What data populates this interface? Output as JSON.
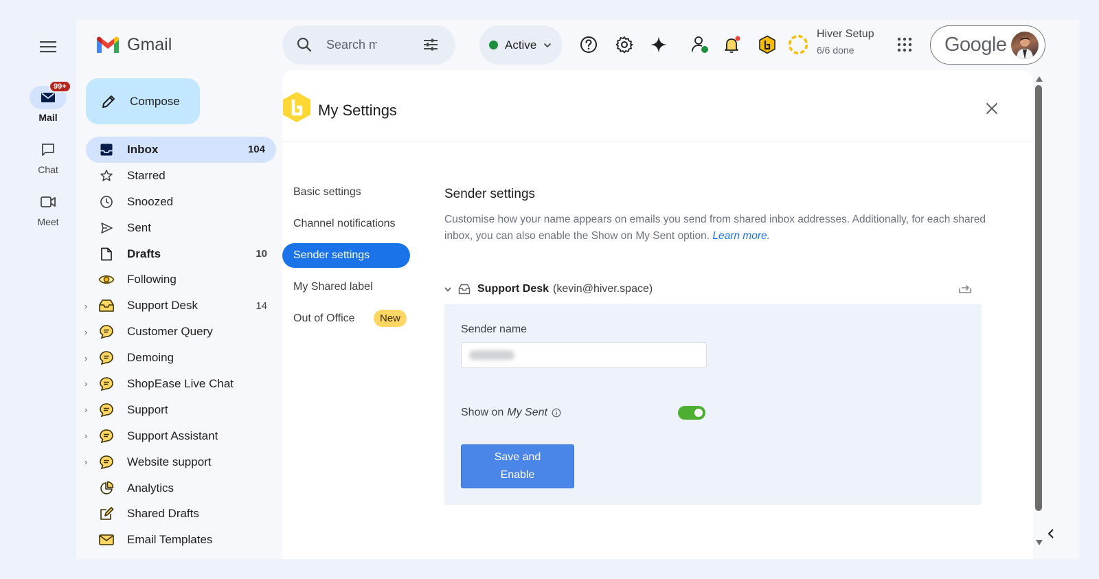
{
  "rail": {
    "mail_label": "Mail",
    "mail_badge": "99+",
    "chat_label": "Chat",
    "meet_label": "Meet"
  },
  "app": {
    "name": "Gmail"
  },
  "compose_label": "Compose",
  "folders": [
    {
      "name": "Inbox",
      "count": "104",
      "icon": "inbox-icon"
    },
    {
      "name": "Starred",
      "count": "",
      "icon": "star-icon"
    },
    {
      "name": "Snoozed",
      "count": "",
      "icon": "clock-icon"
    },
    {
      "name": "Sent",
      "count": "",
      "icon": "send-icon"
    },
    {
      "name": "Drafts",
      "count": "10",
      "icon": "draft-icon"
    },
    {
      "name": "Following",
      "count": "",
      "icon": "eye-icon"
    },
    {
      "name": "Support Desk",
      "count": "14",
      "icon": "shared-inbox-icon"
    },
    {
      "name": "Customer Query",
      "count": "",
      "icon": "chat-bubble-icon"
    },
    {
      "name": "Demoing",
      "count": "",
      "icon": "chat-bubble-icon"
    },
    {
      "name": "ShopEase Live Chat",
      "count": "",
      "icon": "chat-bubble-icon"
    },
    {
      "name": "Support",
      "count": "",
      "icon": "chat-bubble-icon"
    },
    {
      "name": "Support Assistant",
      "count": "",
      "icon": "chat-bubble-icon"
    },
    {
      "name": "Website support",
      "count": "",
      "icon": "chat-bubble-icon"
    },
    {
      "name": "Analytics",
      "count": "",
      "icon": "pie-chart-icon"
    },
    {
      "name": "Shared Drafts",
      "count": "",
      "icon": "edit-note-icon"
    },
    {
      "name": "Email Templates",
      "count": "",
      "icon": "template-icon"
    }
  ],
  "search": {
    "placeholder": "Search m"
  },
  "status": {
    "label": "Active"
  },
  "hiver_setup": {
    "title": "Hiver Setup",
    "progress": "6/6 done"
  },
  "google_word": "Google",
  "settings": {
    "title": "My Settings",
    "nav": [
      "Basic settings",
      "Channel notifications",
      "Sender settings",
      "My Shared label",
      "Out of Office"
    ],
    "new_badge": "New",
    "section_title": "Sender settings",
    "section_desc": "Customise how your name appears on emails you send from shared inbox addresses. Additionally, for each shared inbox, you can also enable the Show on My Sent option.",
    "learn_more": "Learn more.",
    "inbox_name": "Support Desk",
    "inbox_email": "(kevin@hiver.space)",
    "sender_name_label": "Sender name",
    "show_on_label": "Show on",
    "show_on_em": "My Sent",
    "toggle_on": true,
    "save_label_line1": "Save and",
    "save_label_line2": "Enable"
  },
  "colors": {
    "accent": "#1a73e8",
    "compose_bg": "#c2e7ff",
    "toggle_on": "#4caf2f",
    "new_badge": "#fdd663"
  }
}
